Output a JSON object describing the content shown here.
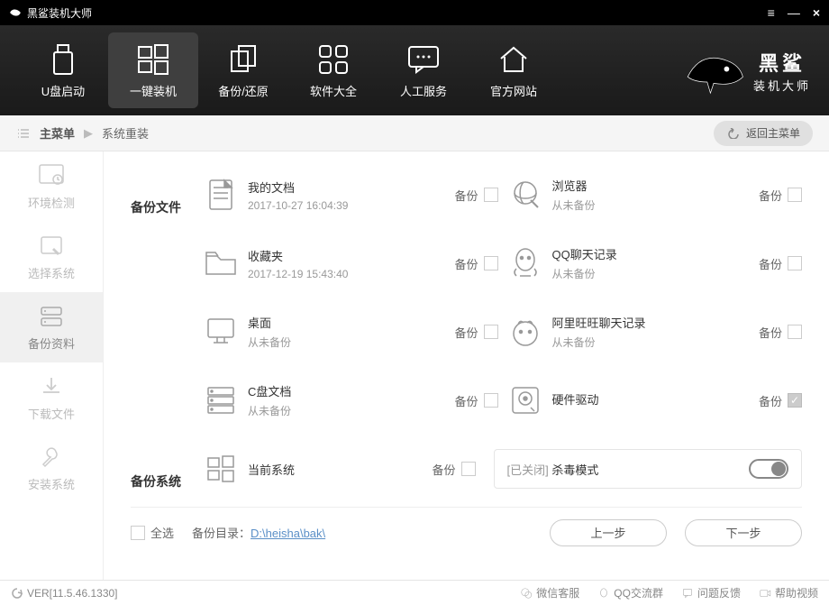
{
  "titlebar": {
    "title": "黑鲨装机大师"
  },
  "topnav": {
    "items": [
      {
        "label": "U盘启动"
      },
      {
        "label": "一键装机"
      },
      {
        "label": "备份/还原"
      },
      {
        "label": "软件大全"
      },
      {
        "label": "人工服务"
      },
      {
        "label": "官方网站"
      }
    ]
  },
  "brand": {
    "big": "黑鲨",
    "small": "装机大师"
  },
  "crumb": {
    "main": "主菜单",
    "sub": "系统重装",
    "back": "返回主菜单"
  },
  "sidebar": {
    "items": [
      {
        "label": "环境检测"
      },
      {
        "label": "选择系统"
      },
      {
        "label": "备份资料"
      },
      {
        "label": "下载文件"
      },
      {
        "label": "安装系统"
      }
    ]
  },
  "content": {
    "section_files": "备份文件",
    "section_system": "备份系统",
    "backup_label": "备份",
    "items_left": [
      {
        "name": "我的文档",
        "sub": "2017-10-27 16:04:39"
      },
      {
        "name": "收藏夹",
        "sub": "2017-12-19 15:43:40"
      },
      {
        "name": "桌面",
        "sub": "从未备份"
      },
      {
        "name": "C盘文档",
        "sub": "从未备份"
      }
    ],
    "items_right": [
      {
        "name": "浏览器",
        "sub": "从未备份"
      },
      {
        "name": "QQ聊天记录",
        "sub": "从未备份"
      },
      {
        "name": "阿里旺旺聊天记录",
        "sub": "从未备份"
      },
      {
        "name": "硬件驱动",
        "sub": ""
      }
    ],
    "system_item": {
      "name": "当前系统",
      "sub": ""
    },
    "kill_mode": {
      "closed": "[已关闭]",
      "label": "杀毒模式"
    },
    "select_all": "全选",
    "backup_dir_label": "备份目录：",
    "backup_dir_path": "D:\\heisha\\bak\\",
    "prev": "上一步",
    "next": "下一步"
  },
  "statusbar": {
    "ver": "VER[11.5.46.1330]",
    "links": [
      {
        "label": "微信客服"
      },
      {
        "label": "QQ交流群"
      },
      {
        "label": "问题反馈"
      },
      {
        "label": "帮助视频"
      }
    ]
  }
}
